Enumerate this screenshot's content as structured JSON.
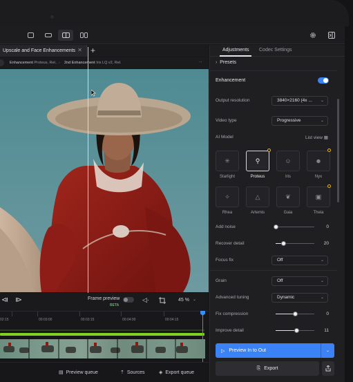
{
  "tabs": {
    "active_label": "Upscale and Face Enhancements"
  },
  "breadcrumb": {
    "first_label": "Enhancement",
    "first_detail": "Proteus, Rel..",
    "second_label": "2nd Enhancement",
    "second_detail": "Iris LQ v2, Rel.",
    "more": "..."
  },
  "controls": {
    "frame_preview_label": "Frame preview",
    "beta_badge": "BETA",
    "zoom_value": "45 %"
  },
  "timeline": {
    "ticks": [
      "02:15",
      "00:03:00",
      "00:03:15",
      "00:04:00",
      "00:04:15"
    ]
  },
  "bottom_bar": {
    "preview_queue": "Preview queue",
    "sources": "Sources",
    "export_queue": "Export queue"
  },
  "panel": {
    "tabs": [
      "Adjustments",
      "Codec Settings"
    ],
    "presets_label": "Presets",
    "enhancement": {
      "title": "Enhancement",
      "enabled": true,
      "output_resolution_label": "Output resolution",
      "output_resolution_value": "3840×2160 (4x ...",
      "video_type_label": "Video type",
      "video_type_value": "Progressive",
      "ai_model_label": "AI Model",
      "list_view_label": "List view",
      "models": [
        {
          "name": "Starlight",
          "selected": false,
          "icon": "sparkle-icon"
        },
        {
          "name": "Proteus",
          "selected": true,
          "icon": "wand-icon"
        },
        {
          "name": "Iris",
          "selected": false,
          "icon": "face-icon"
        },
        {
          "name": "Nyx",
          "selected": false,
          "icon": "moon-face-icon"
        },
        {
          "name": "Rhea",
          "selected": false,
          "icon": "star-icon"
        },
        {
          "name": "Artemis",
          "selected": false,
          "icon": "triangle-icon"
        },
        {
          "name": "Gaia",
          "selected": false,
          "icon": "leaf-icon"
        },
        {
          "name": "Theia",
          "selected": false,
          "icon": "film-icon"
        }
      ]
    },
    "sliders": [
      {
        "label": "Add noise",
        "value": "0",
        "fraction": 0.0
      },
      {
        "label": "Recover detail",
        "value": "20",
        "fraction": 0.2
      }
    ],
    "focus_fix": {
      "label": "Focus fix",
      "value": "Off"
    },
    "grain": {
      "label": "Grain",
      "value": "Off"
    },
    "advanced_tuning": {
      "label": "Advanced tuning",
      "value": "Dynamic"
    },
    "sliders2": [
      {
        "label": "Fix compression",
        "value": "0",
        "fraction": 0.5
      },
      {
        "label": "Improve detail",
        "value": "11",
        "fraction": 0.55
      }
    ],
    "preview_button": "Preview In to Out",
    "export_button": "Export"
  },
  "colors": {
    "accent": "#3b82f6",
    "premium_dot": "#f5b800",
    "timeline_green": "#7ed321"
  }
}
